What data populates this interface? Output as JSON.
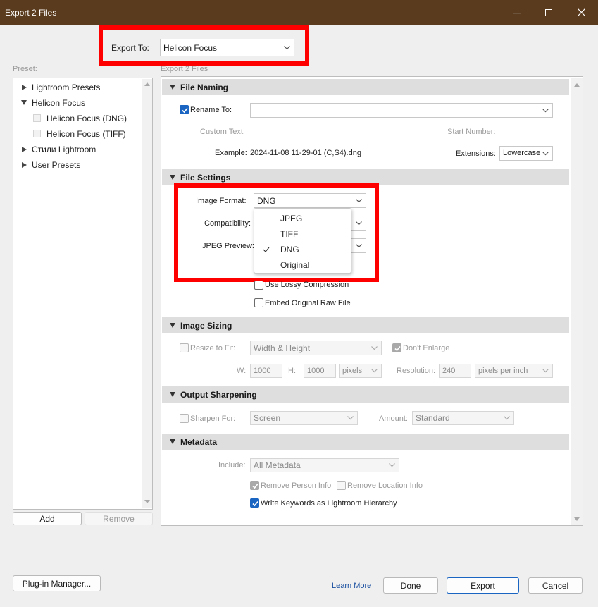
{
  "window": {
    "title": "Export 2 Files"
  },
  "export_to": {
    "label": "Export To:",
    "value": "Helicon Focus"
  },
  "preset": {
    "header": "Preset:",
    "items": [
      {
        "label": "Lightroom Presets"
      },
      {
        "label": "Helicon Focus"
      },
      {
        "label": "Helicon Focus (DNG)"
      },
      {
        "label": "Helicon Focus (TIFF)"
      },
      {
        "label": "Стили Lightroom"
      },
      {
        "label": "User Presets"
      }
    ],
    "add_label": "Add",
    "remove_label": "Remove"
  },
  "panel": {
    "header": "Export 2 Files"
  },
  "file_naming": {
    "title": "File Naming",
    "rename_label": "Rename To:",
    "rename_value": "",
    "custom_text_label": "Custom Text:",
    "start_number_label": "Start Number:",
    "example_label": "Example:",
    "example_value": "2024-11-08 11-29-01 (C,S4).dng",
    "extensions_label": "Extensions:",
    "extensions_value": "Lowercase"
  },
  "file_settings": {
    "title": "File Settings",
    "image_format_label": "Image Format:",
    "image_format_value": "DNG",
    "compatibility_label": "Compatibility:",
    "jpeg_preview_label": "JPEG Preview:",
    "format_options": [
      "JPEG",
      "TIFF",
      "DNG",
      "Original"
    ],
    "selected_option": "DNG",
    "lossy_label": "Use Lossy Compression",
    "embed_label": "Embed Original Raw File"
  },
  "image_sizing": {
    "title": "Image Sizing",
    "resize_label": "Resize to Fit:",
    "resize_value": "Width & Height",
    "dont_enlarge_label": "Don't Enlarge",
    "w_label": "W:",
    "w_value": "1000",
    "h_label": "H:",
    "h_value": "1000",
    "unit_value": "pixels",
    "resolution_label": "Resolution:",
    "resolution_value": "240",
    "resolution_unit": "pixels per inch"
  },
  "output_sharpening": {
    "title": "Output Sharpening",
    "sharpen_label": "Sharpen For:",
    "sharpen_value": "Screen",
    "amount_label": "Amount:",
    "amount_value": "Standard"
  },
  "metadata": {
    "title": "Metadata",
    "include_label": "Include:",
    "include_value": "All Metadata",
    "remove_person_label": "Remove Person Info",
    "remove_location_label": "Remove Location Info",
    "keywords_label": "Write Keywords as Lightroom Hierarchy"
  },
  "footer": {
    "plugin_manager_label": "Plug-in Manager...",
    "learn_more_label": "Learn More",
    "done_label": "Done",
    "export_label": "Export",
    "cancel_label": "Cancel"
  },
  "colors": {
    "titlebar": "#5a3b1d",
    "highlight": "#ff0000",
    "accent": "#1a65c2"
  }
}
